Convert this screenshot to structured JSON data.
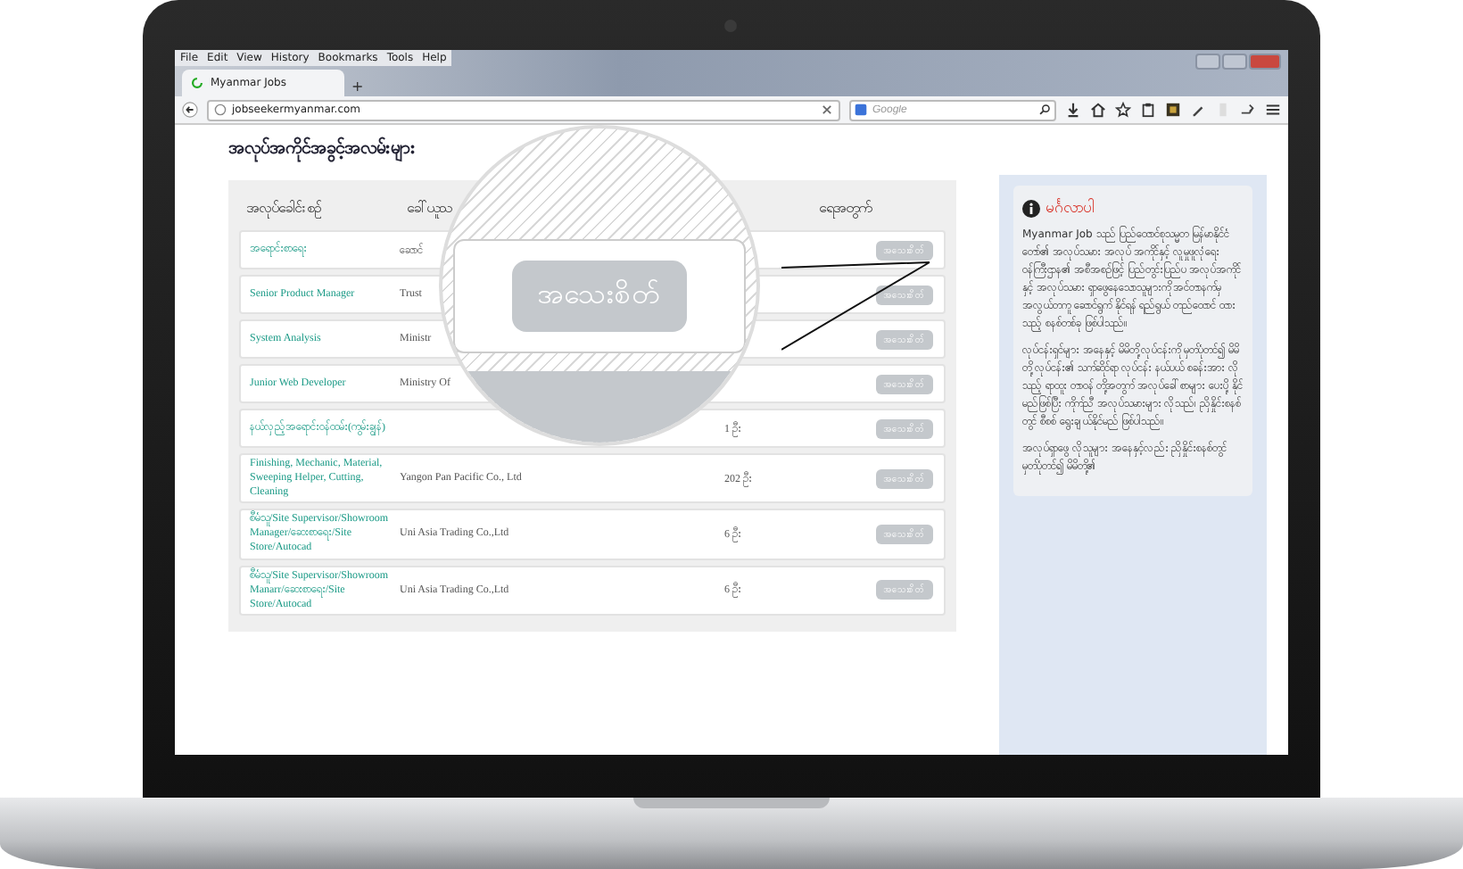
{
  "browser": {
    "menu": [
      "File",
      "Edit",
      "View",
      "History",
      "Bookmarks",
      "Tools",
      "Help"
    ],
    "tab": "Myanmar Jobs",
    "new_tab": "+",
    "url": "jobseekermyanmar.com",
    "search": {
      "placeholder": "Google"
    }
  },
  "page": {
    "heading": "အလုပ်အကိုင်အခွင့်အလမ်းများ",
    "table": {
      "columns": [
        "အလုပ်ခေါင်းစဉ်",
        "ခေါ်ယူသ",
        "ရေအတွက်"
      ],
      "rows": [
        {
          "title": "အရောင်းစာရေး",
          "company": "ဆောင်",
          "button": "အသေးစိတ်"
        },
        {
          "title": "Senior Product Manager",
          "company": "Trust",
          "button": "အသေးစိတ်"
        },
        {
          "title": "System Analysis",
          "company": "Ministr",
          "button": "အသေးစိတ်"
        },
        {
          "title": "Junior Web Developer",
          "company": "Ministry Of",
          "button": "အသေးစိတ်"
        },
        {
          "title": "နယ်လှည့်အရောင်းဝန်ထမ်း(ကွမ်းချွန်)",
          "count": "1 ဦး",
          "button": "အသေးစိတ်"
        },
        {
          "title": "Finishing, Mechanic, Material, Sweeping Helper, Cutting, Cleaning",
          "company": "Yangon Pan Pacific Co., Ltd",
          "count": "202 ဦး",
          "button": "အသေးစိတ်"
        },
        {
          "title": "စီမံသူ/Site Supervisor/Showroom Manager/ဆေးစာရေး/Site Store/Autocad",
          "company": "Uni Asia Trading Co.,Ltd",
          "count": "6 ဦး",
          "button": "အသေးစိတ်"
        },
        {
          "title": "စီမံသူ/Site Supervisor/Showroom Manarr/ဆေးစာရေး/Site Store/Autocad",
          "company": "Uni Asia Trading Co.,Ltd",
          "count": "6 ဦး",
          "button": "အသေးစိတ်"
        }
      ]
    },
    "magnifier": {
      "button": "အသေးစိတ်"
    },
    "sidebar": {
      "title": "မင်္ဂလာပါ",
      "paragraphs": [
        "Myanmar Job သည် ပြည်ထောင်စုသမ္မတ မြန်မာနိုင်ငံတော်၏ အလုပ်သမား အလုပ် အကိုင်နှင့် လူမှုဖူလုံရေး ဝန်ကြီးဌာန၏ အစီအစဉ်ဖြင့် ပြည်တွင်းပြည်ပ အလုပ်အကိုင် နှင့် အလုပ်သမား ရှာဖွေနေသောသူများကို အင်တာနက်မှ အလွယ်တကူ ဆောင်ရွက် နိုင်ရန် ရည်ရွယ် တည်ထောင် ထားသည့် စနစ်တစ်ခု ဖြစ်ပါသည်။",
        "လုပ်ငန်းရှင်များ အနေနှင့် မိမိတို့ လုပ်ငန်းကို မှတ်ပုံတင်၍ မိမိတို့ လုပ်ငန်း၏ သက်ဆိုင်ရာ လုပ်ငန်း နယ်ပယ် စခန်းအား လိုသည့် ရာထူး တာဝန် တို့အတွက် အလုပ်ခေါ်စာများ ပေးပို့ နိုင်မည်ဖြစ်ပြီး ကိုက်ညီ အလုပ်သမားများ လိုသည်၊ ညှိနှိုင်းစနစ်တွင် စီစစ် ရွေးချယ်နိုင်မည် ဖြစ်ပါသည်။",
        "အလုပ်ရှာဖွေ လိုသူများ အနေနှင့်လည်း ညှိနှိုင်းစနစ်တွင် မှတ်ပုံတင်၍ မိမိတို့၏"
      ]
    }
  }
}
